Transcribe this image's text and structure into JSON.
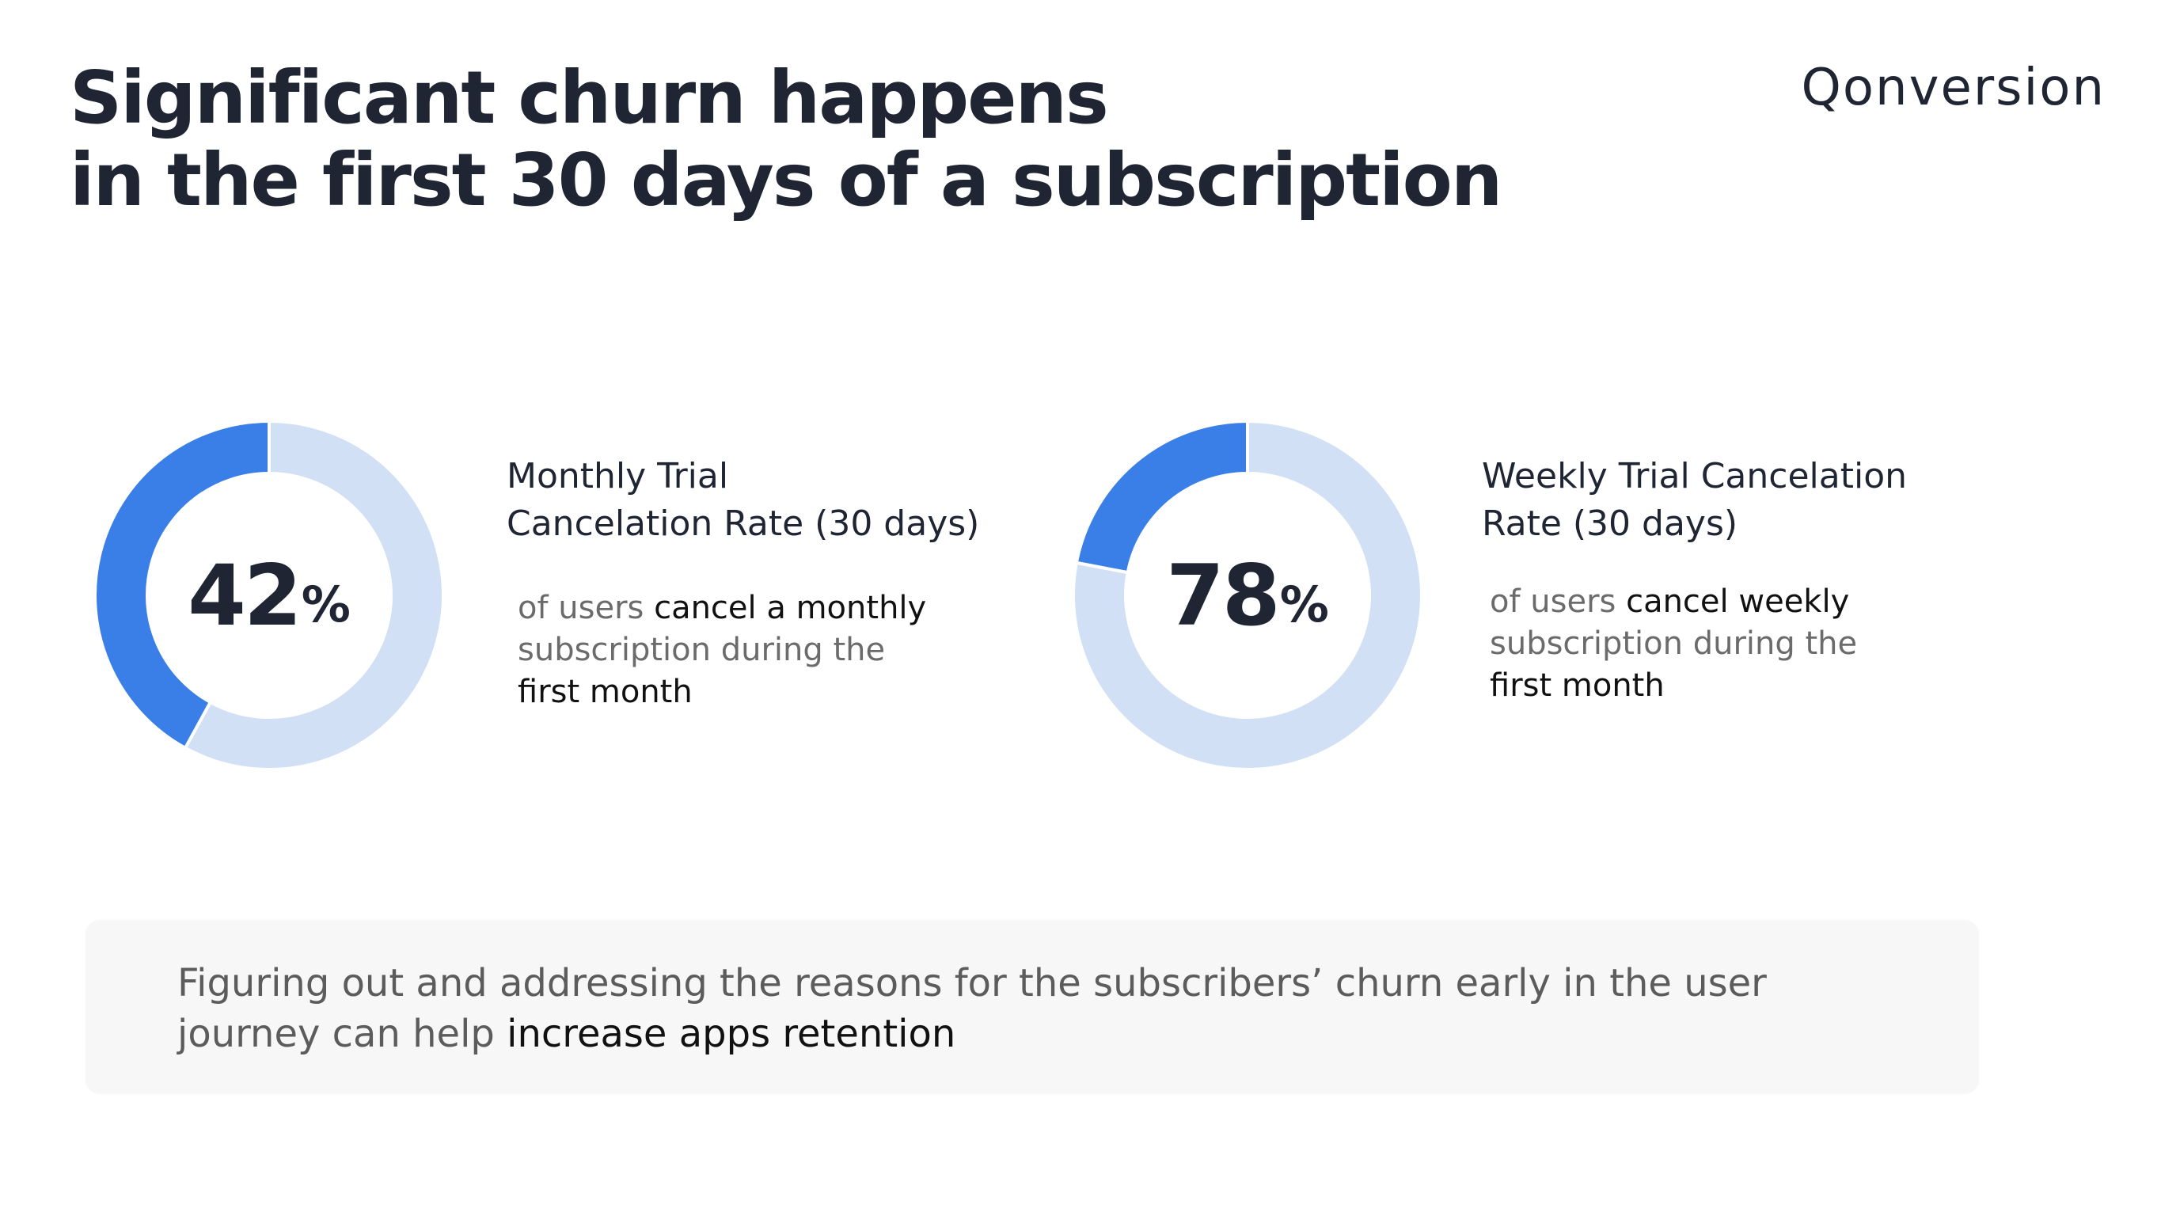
{
  "header": {
    "title_line1": "Significant churn happens",
    "title_line2": "in the first 30 days of a subscription",
    "logo": "Qonversion"
  },
  "colors": {
    "accent": "#3a7fe8",
    "track": "#d2e0f6",
    "text": "#1f2533"
  },
  "chart_data": [
    {
      "type": "pie",
      "value": 42,
      "value_label": "42",
      "unit": "%",
      "max": 100,
      "title_line1": "Monthly Trial",
      "title_line2": "Cancelation Rate (30 days)",
      "desc": {
        "l1_muted": "of users ",
        "l1_hl": "cancel a monthly",
        "l2_muted": "subscription during the",
        "l3_hl": "first month"
      }
    },
    {
      "type": "pie",
      "value": 22,
      "value_label": "78",
      "unit": "%",
      "max": 100,
      "title_line1": "Weekly Trial Cancelation",
      "title_line2": "Rate (30 days)",
      "desc": {
        "l1_muted": "of users ",
        "l1_hl": "cancel  weekly",
        "l2_muted": "subscription during the",
        "l3_hl": "first month"
      }
    }
  ],
  "callout": {
    "line1": "Figuring out and addressing the reasons for the subscribers’ churn early in the user",
    "line2_muted": "journey can help ",
    "line2_hl": "increase apps retention"
  }
}
